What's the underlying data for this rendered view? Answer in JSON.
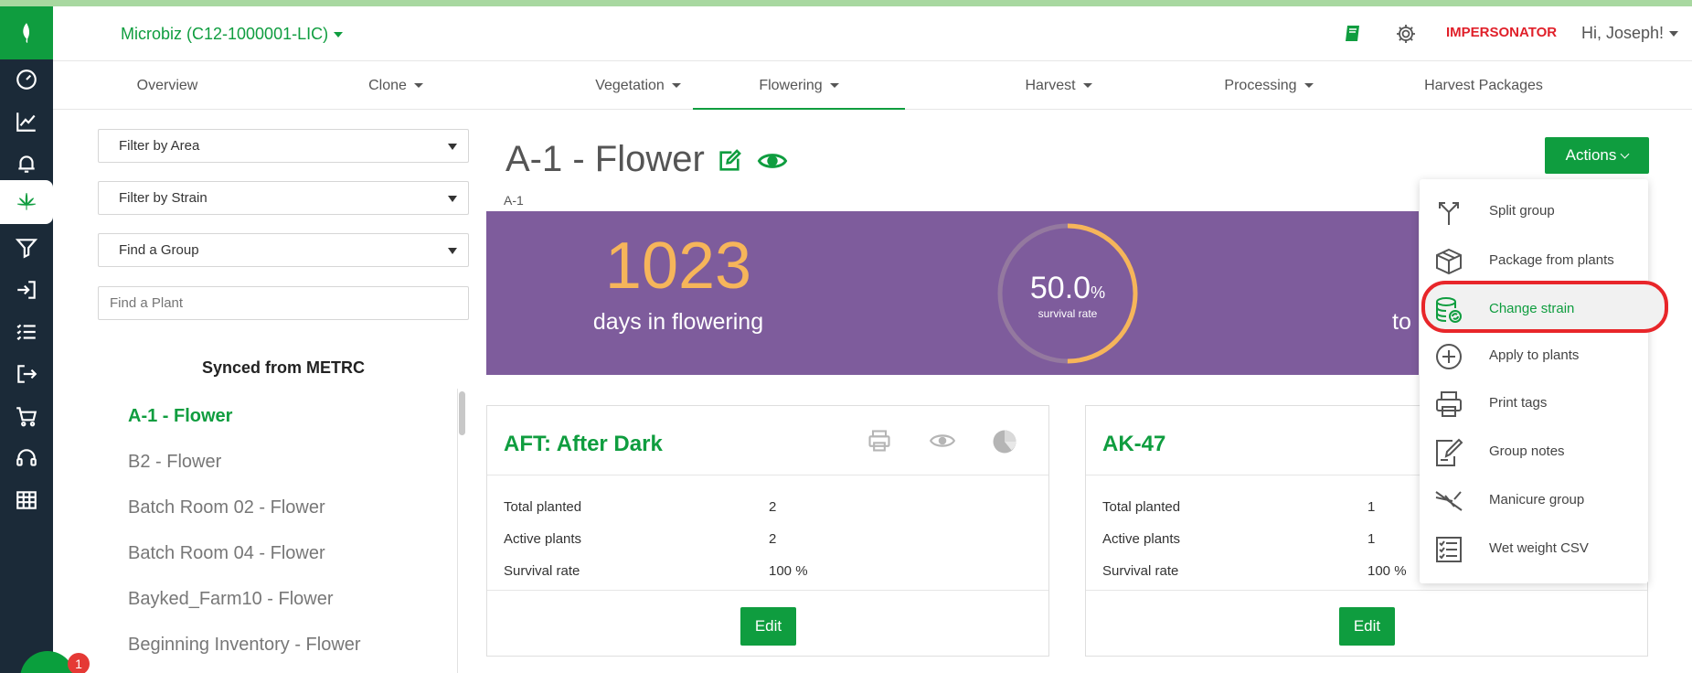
{
  "header": {
    "org_selector": "Microbiz (C12-1000001-LIC)",
    "impersonator": "IMPERSONATOR",
    "greeting": "Hi, Joseph!"
  },
  "tabs": [
    {
      "label": "Overview",
      "has_dropdown": false
    },
    {
      "label": "Clone",
      "has_dropdown": true
    },
    {
      "label": "Vegetation",
      "has_dropdown": true
    },
    {
      "label": "Flowering",
      "has_dropdown": true,
      "active": true
    },
    {
      "label": "Harvest",
      "has_dropdown": true
    },
    {
      "label": "Processing",
      "has_dropdown": true
    },
    {
      "label": "Harvest Packages",
      "has_dropdown": false
    }
  ],
  "sidebar": {
    "filter_area": "Filter by Area",
    "filter_strain": "Filter by Strain",
    "find_group": "Find a Group",
    "find_plant_placeholder": "Find a Plant",
    "section_title": "Synced from METRC",
    "groups": [
      {
        "label": "A-1 - Flower",
        "active": true
      },
      {
        "label": "B2 - Flower"
      },
      {
        "label": "Batch Room 02 - Flower"
      },
      {
        "label": "Batch Room 04 - Flower"
      },
      {
        "label": "Bayked_Farm10 - Flower"
      },
      {
        "label": "Beginning Inventory - Flower"
      }
    ]
  },
  "rail_icons": [
    "leaf-logo-icon",
    "dashboard-icon",
    "chart-icon",
    "bell-icon",
    "cannabis-icon",
    "filter-icon",
    "sign-in-icon",
    "checklist-icon",
    "sign-out-icon",
    "cart-icon",
    "headset-icon",
    "table-icon"
  ],
  "chat": {
    "badge": "1"
  },
  "main": {
    "title": "A-1 - Flower",
    "subtitle": "A-1",
    "actions_label": "Actions",
    "stats": {
      "days": "1023",
      "days_label": "days in flowering",
      "survival_value": "50.0",
      "survival_unit": "%",
      "survival_label": "survival rate",
      "survival_fraction": 0.5,
      "right_partial": "to"
    },
    "cards": [
      {
        "title": "AFT: After Dark",
        "rows": [
          {
            "label": "Total planted",
            "value": "2"
          },
          {
            "label": "Active plants",
            "value": "2"
          },
          {
            "label": "Survival rate",
            "value": "100 %"
          }
        ],
        "edit_label": "Edit"
      },
      {
        "title": "AK-47",
        "rows": [
          {
            "label": "Total planted",
            "value": "1"
          },
          {
            "label": "Active plants",
            "value": "1"
          },
          {
            "label": "Survival rate",
            "value": "100 %"
          }
        ],
        "edit_label": "Edit"
      }
    ]
  },
  "actions_menu": [
    {
      "label": "Split group",
      "icon": "split-icon"
    },
    {
      "label": "Package from plants",
      "icon": "package-icon"
    },
    {
      "label": "Change strain",
      "icon": "database-refresh-icon",
      "highlighted": true
    },
    {
      "label": "Apply to plants",
      "icon": "plus-circle-icon"
    },
    {
      "label": "Print tags",
      "icon": "printer-icon"
    },
    {
      "label": "Group notes",
      "icon": "notes-icon"
    },
    {
      "label": "Manicure group",
      "icon": "scissors-icon"
    },
    {
      "label": "Wet weight CSV",
      "icon": "checklist-icon"
    }
  ],
  "colors": {
    "brand_green": "#0f9d3f",
    "banner_purple": "#7e5c9c",
    "accent_orange": "#f6b55a",
    "rail_dark": "#1b2a38",
    "highlight_red": "#e8262a"
  }
}
